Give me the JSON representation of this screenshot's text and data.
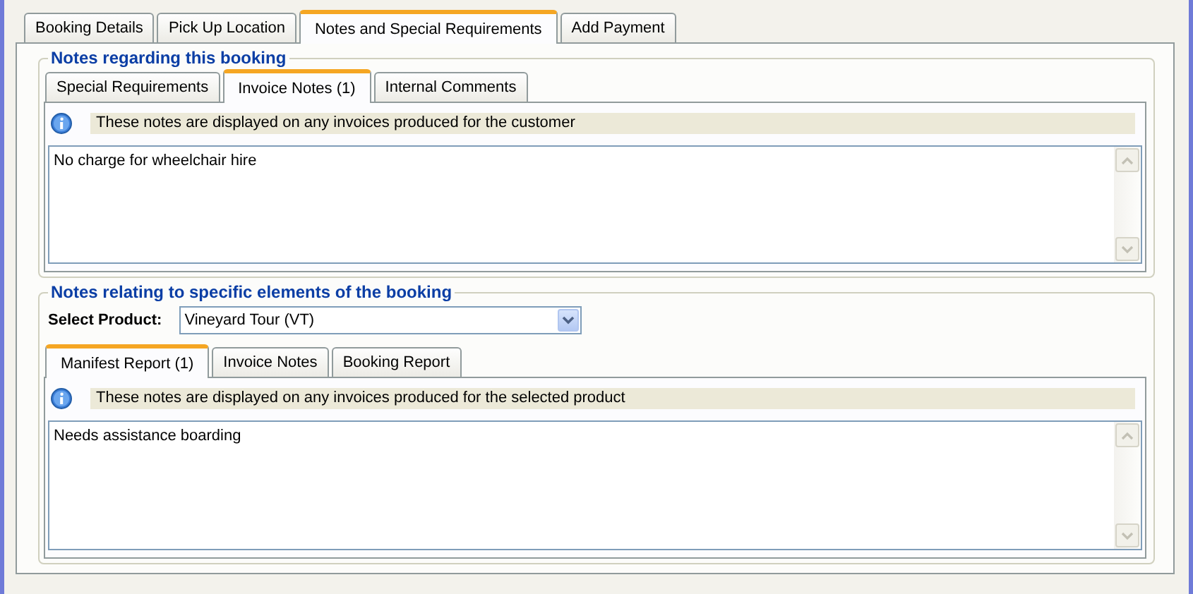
{
  "tabs": [
    {
      "label": "Booking Details",
      "selected": false
    },
    {
      "label": "Pick Up Location",
      "selected": false
    },
    {
      "label": "Notes and Special Requirements",
      "selected": true
    },
    {
      "label": "Add Payment",
      "selected": false
    }
  ],
  "booking_notes": {
    "title": "Notes regarding this booking",
    "tabs": [
      {
        "label": "Special Requirements",
        "selected": false
      },
      {
        "label": "Invoice Notes (1)",
        "selected": true
      },
      {
        "label": "Internal Comments",
        "selected": false
      }
    ],
    "info": "These notes are displayed on any invoices produced for the customer",
    "notes": "No charge for wheelchair hire"
  },
  "element_notes": {
    "title": "Notes relating to specific elements of the booking",
    "select_label": "Select Product:",
    "product": "Vineyard Tour (VT)",
    "tabs": [
      {
        "label": "Manifest Report (1)",
        "selected": true
      },
      {
        "label": "Invoice Notes",
        "selected": false
      },
      {
        "label": "Booking Report",
        "selected": false
      }
    ],
    "info": "These notes are displayed on any invoices produced for the selected product",
    "notes": "Needs assistance boarding"
  }
}
